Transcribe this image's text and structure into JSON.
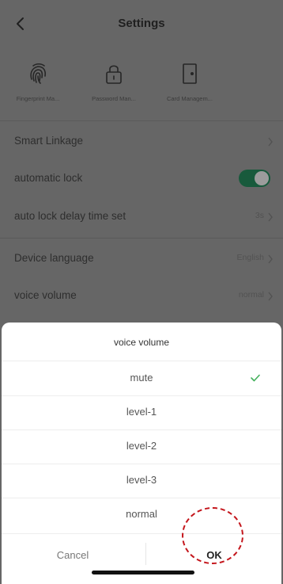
{
  "header": {
    "title": "Settings"
  },
  "tiles": [
    {
      "icon": "fingerprint-icon",
      "label": "Fingerprint Ma..."
    },
    {
      "icon": "lock-icon",
      "label": "Password Man..."
    },
    {
      "icon": "door-icon",
      "label": "Card Managem..."
    }
  ],
  "settings": {
    "smart_linkage": "Smart Linkage",
    "automatic_lock": "automatic lock",
    "automatic_lock_on": true,
    "auto_lock_delay": {
      "label": "auto lock delay time set",
      "value": "3s"
    },
    "device_language": {
      "label": "Device language",
      "value": "English"
    },
    "voice_volume": {
      "label": "voice volume",
      "value": "normal"
    }
  },
  "sheet": {
    "title": "voice volume",
    "options": [
      "mute",
      "level-1",
      "level-2",
      "level-3",
      "normal"
    ],
    "selected": "mute",
    "cancel": "Cancel",
    "ok": "OK"
  },
  "colors": {
    "accent": "#43b05c",
    "toggle_on": "#185a3c",
    "highlight_ring": "#c4161c"
  }
}
